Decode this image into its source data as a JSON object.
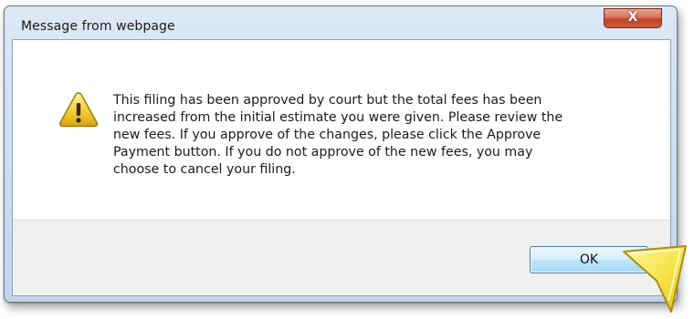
{
  "dialog": {
    "title": "Message from webpage",
    "close_label": "X",
    "close_icon": "close-icon",
    "warning_icon": "warning-triangle-icon",
    "message_lines": [
      "This filing has been approved by court but the total fees has been",
      "increased from the initial estimate you were given.  Please review the",
      "new fees.  If you approve of the changes, please click the Approve",
      "Payment button.  If you do not approve of the new fees, you may",
      "choose to cancel your filing."
    ],
    "ok_label": "OK"
  },
  "colors": {
    "frame": "#cfe0f1",
    "close_button": "#c2432a",
    "ok_button_border": "#3c7fb1",
    "pointer": "#f7e74a"
  }
}
